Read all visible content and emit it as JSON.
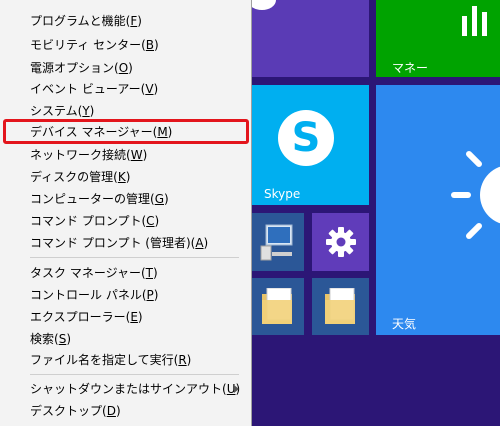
{
  "menu": {
    "items": [
      {
        "label": "プログラムと機能(",
        "key": "F",
        "suffix": ")"
      },
      {
        "label": "モビリティ センター(",
        "key": "B",
        "suffix": ")"
      },
      {
        "label": "電源オプション(",
        "key": "O",
        "suffix": ")"
      },
      {
        "label": "イベント ビューアー(",
        "key": "V",
        "suffix": ")"
      },
      {
        "label": "システム(",
        "key": "Y",
        "suffix": ")"
      },
      {
        "label": "デバイス マネージャー(",
        "key": "M",
        "suffix": ")"
      },
      {
        "label": "ネットワーク接続(",
        "key": "W",
        "suffix": ")"
      },
      {
        "label": "ディスクの管理(",
        "key": "K",
        "suffix": ")"
      },
      {
        "label": "コンピューターの管理(",
        "key": "G",
        "suffix": ")"
      },
      {
        "label": "コマンド プロンプト(",
        "key": "C",
        "suffix": ")"
      },
      {
        "label": "コマンド プロンプト (管理者)(",
        "key": "A",
        "suffix": ")"
      },
      {
        "label": "タスク マネージャー(",
        "key": "T",
        "suffix": ")"
      },
      {
        "label": "コントロール パネル(",
        "key": "P",
        "suffix": ")"
      },
      {
        "label": "エクスプローラー(",
        "key": "E",
        "suffix": ")"
      },
      {
        "label": "検索(",
        "key": "S",
        "suffix": ")"
      },
      {
        "label": "ファイル名を指定して実行(",
        "key": "R",
        "suffix": ")"
      },
      {
        "label": "シャットダウンまたはサインアウト(",
        "key": "U",
        "suffix": ")"
      },
      {
        "label": "デスクトップ(",
        "key": "D",
        "suffix": ")"
      }
    ]
  },
  "tiles": {
    "money": {
      "label": "マネー",
      "color": "#00a300"
    },
    "skype": {
      "label": "Skype",
      "color": "#00aff0"
    },
    "weather": {
      "label": "天気",
      "color": "#2d89ef"
    },
    "settings": {
      "color": "#603cba"
    },
    "computer": {
      "color": "#2b5797"
    },
    "folder1": {
      "color": "#2b5797"
    },
    "folder2": {
      "color": "#2b5797"
    }
  },
  "colors": {
    "background": "#2c1676",
    "highlight": "#e3151c"
  }
}
